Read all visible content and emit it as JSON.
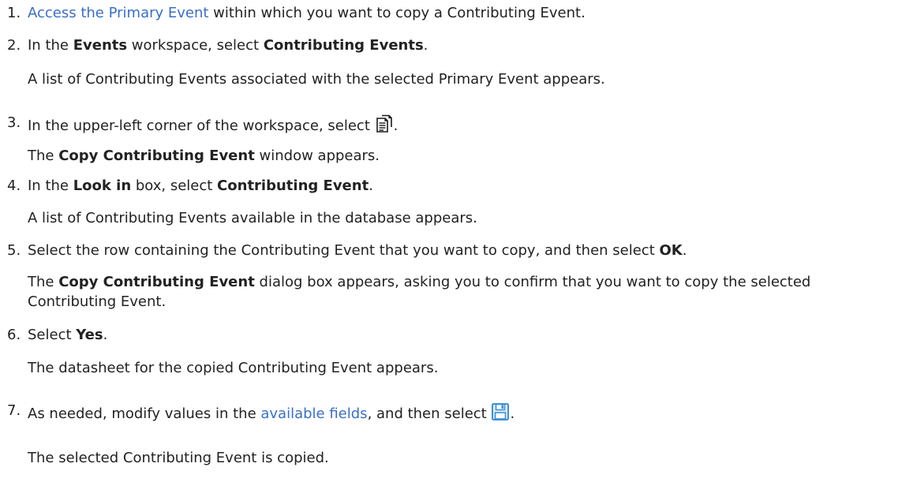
{
  "steps": [
    {
      "num": "1.",
      "link": "Access the Primary Event",
      "rest": " within which you want to copy a Contributing Event."
    },
    {
      "num": "2.",
      "p1": "In the ",
      "b1": "Events",
      "p2": " workspace, select ",
      "b2": "Contributing Events",
      "p3": ".",
      "result": "A list of Contributing Events associated with the selected Primary Event appears."
    },
    {
      "num": "3.",
      "p1": "In the upper-left corner of the workspace, select ",
      "icon": "copy-icon",
      "p2": ".",
      "result_p1": "The ",
      "result_b": "Copy Contributing Event",
      "result_p2": " window appears."
    },
    {
      "num": "4.",
      "p1": "In the ",
      "b1": "Look in",
      "p2": " box, select ",
      "b2": "Contributing Event",
      "p3": ".",
      "result": "A list of Contributing Events available in the database appears."
    },
    {
      "num": "5.",
      "p1": "Select the row containing the Contributing Event that you want to copy, and then select ",
      "b1": "OK",
      "p2": ".",
      "result_p1": "The ",
      "result_b": "Copy Contributing Event",
      "result_p2": " dialog box appears, asking you to confirm that you want to copy the selected Contributing Event."
    },
    {
      "num": "6.",
      "p1": "Select ",
      "b1": "Yes",
      "p2": ".",
      "result": "The datasheet for the copied Contributing Event appears."
    },
    {
      "num": "7.",
      "p1": "As needed, modify values in the ",
      "link": "available fields",
      "p2": ", and then select ",
      "icon": "save-icon",
      "p3": ".",
      "result": "The selected Contributing Event is copied."
    }
  ],
  "colors": {
    "link": "#3a6fc7",
    "text": "#222222",
    "save_icon": "#3f8fd8"
  }
}
